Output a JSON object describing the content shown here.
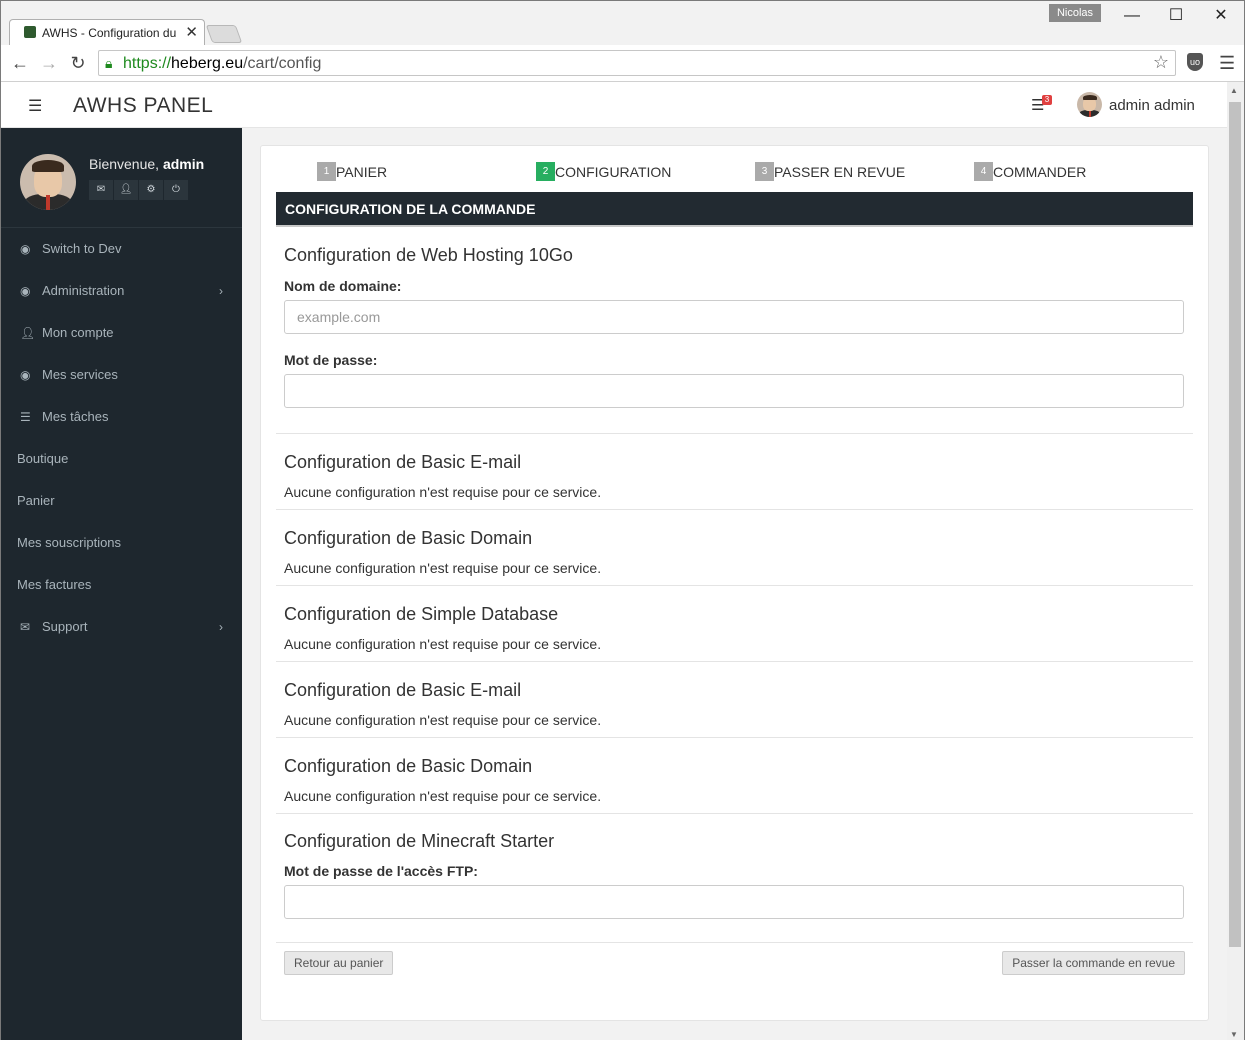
{
  "browser": {
    "tab_title": "AWHS - Configuration du",
    "profile_name": "Nicolas",
    "url_scheme": "https://",
    "url_host": "heberg.eu",
    "url_path": "/cart/config",
    "ublock_label": "uo"
  },
  "header": {
    "brand": "AWHS PANEL",
    "tasks_badge": "3",
    "user_name": "admin admin"
  },
  "sidebar": {
    "welcome_prefix": "Bienvenue, ",
    "welcome_user": "admin",
    "items": [
      {
        "label": "Switch to Dev",
        "icon": "dashboard-icon",
        "has_chevron": false
      },
      {
        "label": "Administration",
        "icon": "dashboard-icon",
        "has_chevron": true
      },
      {
        "label": "Mon compte",
        "icon": "user-icon",
        "has_chevron": false
      },
      {
        "label": "Mes services",
        "icon": "dashboard-icon",
        "has_chevron": false
      },
      {
        "label": "Mes tâches",
        "icon": "list-icon",
        "has_chevron": false
      },
      {
        "label": "Boutique",
        "icon": "",
        "has_chevron": false
      },
      {
        "label": "Panier",
        "icon": "",
        "has_chevron": false
      },
      {
        "label": "Mes souscriptions",
        "icon": "",
        "has_chevron": false
      },
      {
        "label": "Mes factures",
        "icon": "",
        "has_chevron": false
      },
      {
        "label": "Support",
        "icon": "envelope-icon",
        "has_chevron": true
      }
    ]
  },
  "steps": [
    {
      "num": "1",
      "label": "PANIER",
      "active": false
    },
    {
      "num": "2",
      "label": "CONFIGURATION",
      "active": true
    },
    {
      "num": "3",
      "label": "PASSER EN REVUE",
      "active": false
    },
    {
      "num": "4",
      "label": "COMMANDER",
      "active": false
    }
  ],
  "card": {
    "header": "CONFIGURATION DE LA COMMANDE",
    "web_hosting": {
      "title": "Configuration de Web Hosting 10Go",
      "domain_label": "Nom de domaine:",
      "domain_placeholder": "example.com",
      "password_label": "Mot de passe:"
    },
    "sections": [
      {
        "title": "Configuration de Basic E-mail",
        "note": "Aucune configuration n'est requise pour ce service."
      },
      {
        "title": "Configuration de Basic Domain",
        "note": "Aucune configuration n'est requise pour ce service."
      },
      {
        "title": "Configuration de Simple Database",
        "note": "Aucune configuration n'est requise pour ce service."
      },
      {
        "title": "Configuration de Basic E-mail",
        "note": "Aucune configuration n'est requise pour ce service."
      },
      {
        "title": "Configuration de Basic Domain",
        "note": "Aucune configuration n'est requise pour ce service."
      }
    ],
    "minecraft": {
      "title": "Configuration de Minecraft Starter",
      "ftp_label": "Mot de passe de l'accès FTP:"
    },
    "back_button": "Retour au panier",
    "review_button": "Passer la commande en revue"
  }
}
